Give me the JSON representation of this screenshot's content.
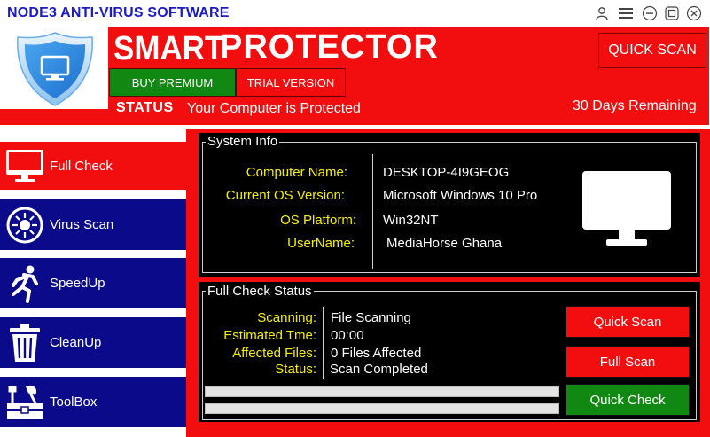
{
  "window": {
    "title": "NODE3 ANTI-VIRUS SOFTWARE"
  },
  "header": {
    "brand_smart": "SMART",
    "brand_protector": "PROTECTOR",
    "quick_scan": "QUICK SCAN",
    "buy_premium": "BUY PREMIUM",
    "trial_version": "TRIAL VERSION",
    "status_label": "STATUS",
    "status_text": "Your Computer is Protected",
    "days_remaining": "30 Days Remaining"
  },
  "sidebar": {
    "items": [
      {
        "label": "Full Check",
        "icon": "monitor-icon",
        "active": true
      },
      {
        "label": "Virus Scan",
        "icon": "virus-icon"
      },
      {
        "label": "SpeedUp",
        "icon": "runner-icon"
      },
      {
        "label": "CleanUp",
        "icon": "trash-icon"
      },
      {
        "label": "ToolBox",
        "icon": "toolbox-icon"
      }
    ]
  },
  "system_info": {
    "title": "System Info",
    "rows": [
      {
        "label": "Computer Name:",
        "value": "DESKTOP-4I9GEOG"
      },
      {
        "label": "Current OS Version:",
        "value": "Microsoft Windows 10 Pro"
      },
      {
        "label": "OS Platform:",
        "value": "Win32NT"
      },
      {
        "label": "UserName:",
        "value": "MediaHorse Ghana"
      }
    ]
  },
  "full_check": {
    "title": "Full Check Status",
    "rows": [
      {
        "label": "Scanning:",
        "value": "File Scanning"
      },
      {
        "label": "Estimated Tme:",
        "value": "00:00"
      },
      {
        "label": "Affected Files:",
        "value": "0 Files Affected"
      },
      {
        "label": "Status:",
        "value": "Scan Completed"
      }
    ],
    "buttons": {
      "quick_scan": "Quick Scan",
      "full_scan": "Full Scan",
      "quick_check": "Quick Check"
    },
    "progress": [
      0,
      0
    ]
  },
  "colors": {
    "red": "#f20e0e",
    "navy": "#0a0a8a",
    "green": "#118811",
    "yellow_label": "#f5f000",
    "title_blue": "#1b1bc8"
  }
}
